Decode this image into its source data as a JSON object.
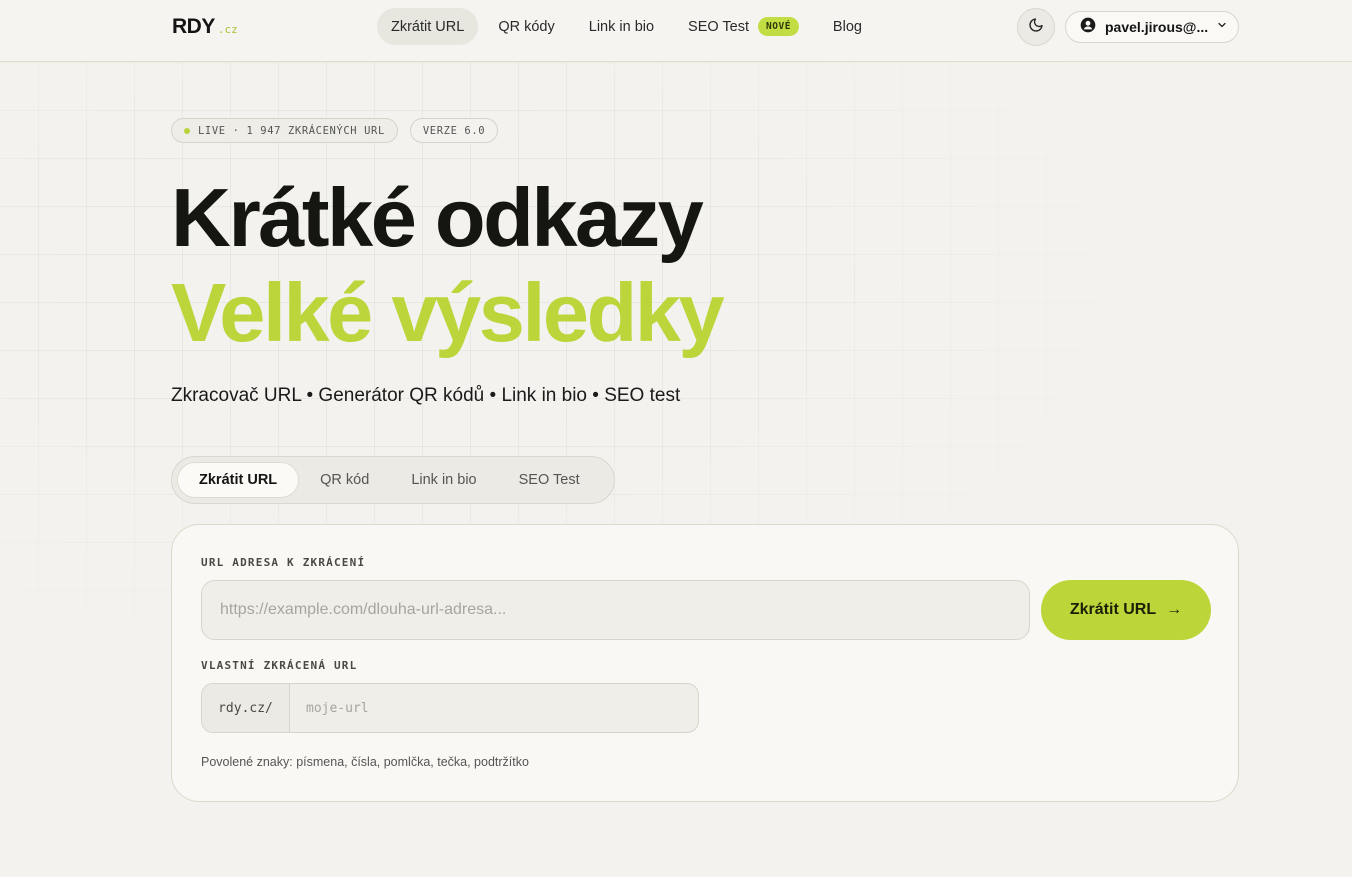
{
  "header": {
    "logo_main": "RDY",
    "logo_tld": ".cz",
    "nav": [
      {
        "label": "Zkrátit URL",
        "active": true
      },
      {
        "label": "QR kódy"
      },
      {
        "label": "Link in bio"
      },
      {
        "label": "SEO Test",
        "badge": "NOVÉ"
      },
      {
        "label": "Blog"
      }
    ],
    "user_name": "pavel.jirous@..."
  },
  "hero": {
    "live_label": "LIVE · 1 947 ZKRÁCENÝCH URL",
    "version_label": "VERZE 6.0",
    "title_line1": "Krátké odkazy",
    "title_line2": "Velké výsledky",
    "subtitle": "Zkracovač URL • Generátor QR kódů • Link in bio • SEO test"
  },
  "tabs": [
    {
      "label": "Zkrátit URL",
      "active": true
    },
    {
      "label": "QR kód"
    },
    {
      "label": "Link in bio"
    },
    {
      "label": "SEO Test"
    }
  ],
  "form": {
    "url_label": "URL ADRESA K ZKRÁCENÍ",
    "url_placeholder": "https://example.com/dlouha-url-adresa...",
    "submit_label": "Zkrátit URL",
    "submit_arrow": "→",
    "custom_label": "VLASTNÍ ZKRÁCENÁ URL",
    "custom_prefix": "rdy.cz/",
    "custom_placeholder": "moje-url",
    "hint": "Povolené znaky: písmena, čísla, pomlčka, tečka, podtržítko"
  },
  "colors": {
    "accent": "#bcd53a",
    "background": "#f3f2ee",
    "text": "#151512"
  }
}
